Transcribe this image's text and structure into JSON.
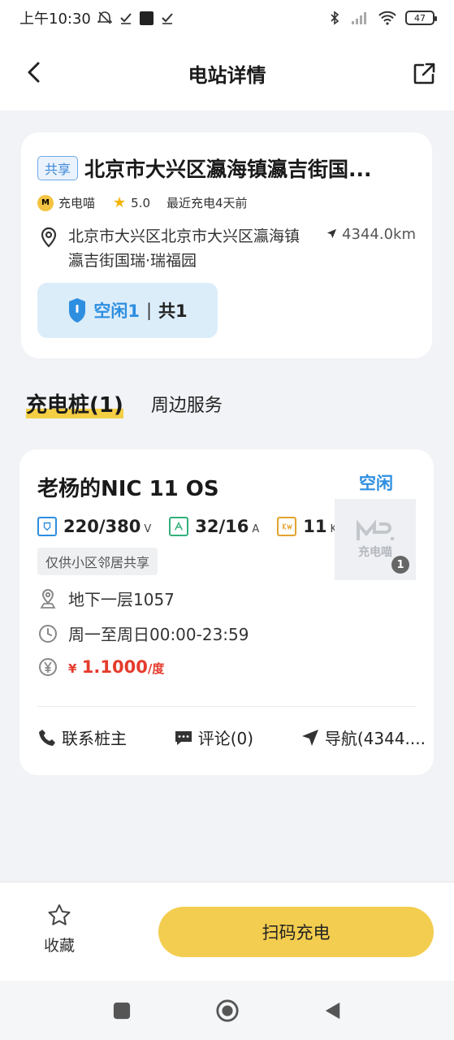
{
  "status_bar": {
    "time": "上午10:30",
    "battery": "47"
  },
  "header": {
    "title": "电站详情"
  },
  "station": {
    "tag": "共享",
    "name": "北京市大兴区瀛海镇瀛吉街国...",
    "brand": "充电喵",
    "brand_icon_text": "M",
    "rating": "5.0",
    "recent": "最近充电4天前",
    "address": "北京市大兴区北京市大兴区瀛海镇瀛吉街国瑞·瑞福园",
    "distance": "4344.0km",
    "idle_label": "空闲1",
    "separator": "|",
    "total_label": "共1"
  },
  "tabs": {
    "charging_piles": "充电桩(1)",
    "nearby_services": "周边服务"
  },
  "pile": {
    "name": "老杨的NIC 11 OS",
    "status": "空闲",
    "voltage": "220/380",
    "voltage_unit": "V",
    "current": "32/16",
    "current_unit": "A",
    "power": "11",
    "power_unit": "KW",
    "notice": "仅供小区邻居共享",
    "location": "地下一层1057",
    "hours": "周一至周日00:00-23:59",
    "price_symbol": "¥",
    "price": "1.1000",
    "price_unit": "/度",
    "thumb_text": "充电喵",
    "photo_count": "1",
    "actions": {
      "contact": "联系桩主",
      "comments": "评论(0)",
      "navigate": "导航(4344...."
    }
  },
  "bottom": {
    "favorite": "收藏",
    "scan_charge": "扫码充电"
  },
  "colors": {
    "accent_yellow": "#f3cd4f",
    "idle_blue": "#2e8fe0",
    "price_red": "#e53b2c"
  }
}
